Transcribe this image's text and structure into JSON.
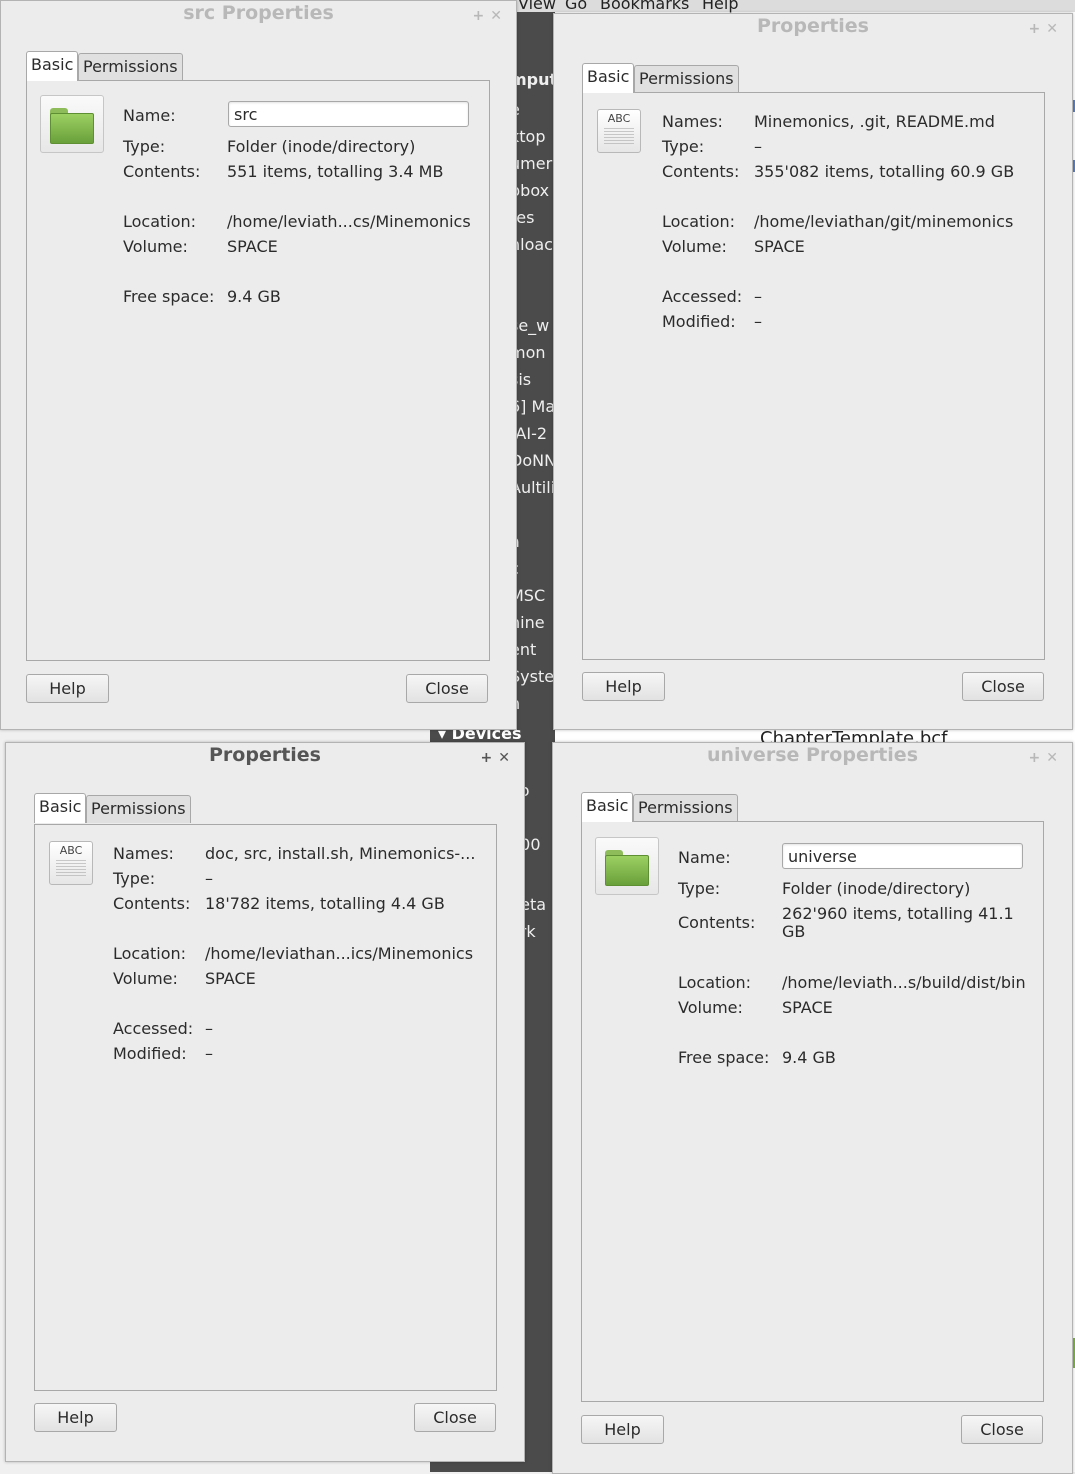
{
  "background": {
    "menu": [
      "View",
      "Go",
      "Bookmarks",
      "Help"
    ],
    "sidebar_items": [
      "mput",
      "e",
      "ktop",
      "umer",
      "pbox",
      "res",
      "nloac",
      "se_w",
      "mon",
      "sis",
      "6] Ma",
      "-AI-2",
      "DoNN",
      "Aultili",
      "a",
      "c",
      "MSC",
      "hine",
      "ent",
      "Syste",
      "n",
      "E",
      "Vo",
      "m",
      "300",
      "k",
      "neta",
      "ork"
    ],
    "devices_label": "Devices",
    "file_label": "ChapterTemplate.bcf"
  },
  "dialogs": [
    {
      "title": "src Properties",
      "tabs": [
        "Basic",
        "Permissions"
      ],
      "icon": "folder-icon",
      "name_label": "Name:",
      "name_value": "src",
      "fields": [
        {
          "label": "Type:",
          "value": "Folder (inode/directory)"
        },
        {
          "label": "Contents:",
          "value": "551 items, totalling 3.4 MB"
        },
        {
          "label": "Location:",
          "value": "/home/leviath...cs/Minemonics"
        },
        {
          "label": "Volume:",
          "value": "SPACE"
        },
        {
          "label": "Free space:",
          "value": "9.4 GB"
        }
      ],
      "help": "Help",
      "close": "Close"
    },
    {
      "title": "Properties",
      "tabs": [
        "Basic",
        "Permissions"
      ],
      "icon": "text-document-icon",
      "icon_text": "ABC",
      "fields": [
        {
          "label": "Names:",
          "value": "Minemonics, .git, README.md"
        },
        {
          "label": "Type:",
          "value": "–"
        },
        {
          "label": "Contents:",
          "value": "355'082 items, totalling 60.9 GB"
        },
        {
          "label": "Location:",
          "value": "/home/leviathan/git/minemonics"
        },
        {
          "label": "Volume:",
          "value": "SPACE"
        },
        {
          "label": "Accessed:",
          "value": "–"
        },
        {
          "label": "Modified:",
          "value": "–"
        }
      ],
      "help": "Help",
      "close": "Close"
    },
    {
      "title": "Properties",
      "tabs": [
        "Basic",
        "Permissions"
      ],
      "icon": "text-document-icon",
      "icon_text": "ABC",
      "fields": [
        {
          "label": "Names:",
          "value": "doc, src, install.sh, Minemonics-..."
        },
        {
          "label": "Type:",
          "value": "–"
        },
        {
          "label": "Contents:",
          "value": "18'782 items, totalling 4.4 GB"
        },
        {
          "label": "Location:",
          "value": "/home/leviathan...ics/Minemonics"
        },
        {
          "label": "Volume:",
          "value": "SPACE"
        },
        {
          "label": "Accessed:",
          "value": "–"
        },
        {
          "label": "Modified:",
          "value": "–"
        }
      ],
      "help": "Help",
      "close": "Close"
    },
    {
      "title": "universe Properties",
      "tabs": [
        "Basic",
        "Permissions"
      ],
      "icon": "folder-icon",
      "name_label": "Name:",
      "name_value": "universe",
      "fields": [
        {
          "label": "Type:",
          "value": "Folder (inode/directory)"
        },
        {
          "label": "Contents:",
          "value": "262'960 items, totalling 41.1"
        },
        {
          "label": "",
          "value": "GB"
        },
        {
          "label": "Location:",
          "value": "/home/leviath...s/build/dist/bin"
        },
        {
          "label": "Volume:",
          "value": "SPACE"
        },
        {
          "label": "Free space:",
          "value": "9.4 GB"
        }
      ],
      "help": "Help",
      "close": "Close"
    }
  ]
}
